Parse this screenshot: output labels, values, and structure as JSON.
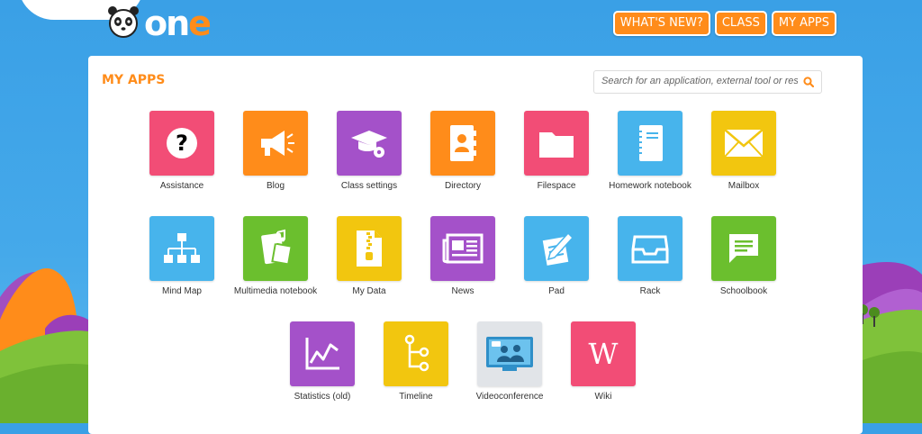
{
  "brand": {
    "logo_text_a": "on",
    "logo_text_b": "e"
  },
  "topnav": [
    {
      "label": "What's new?"
    },
    {
      "label": "Class"
    },
    {
      "label": "My apps"
    }
  ],
  "main": {
    "title": "MY APPS",
    "search_placeholder": "Search for an application, external tool or resource"
  },
  "apps": [
    {
      "label": "Assistance",
      "icon": "question-icon",
      "color": "#f24d76"
    },
    {
      "label": "Blog",
      "icon": "megaphone-icon",
      "color": "#ff8c1a"
    },
    {
      "label": "Class settings",
      "icon": "graduation-cap-gear-icon",
      "color": "#a451c9"
    },
    {
      "label": "Directory",
      "icon": "contact-book-icon",
      "color": "#ff8c1a"
    },
    {
      "label": "Filespace",
      "icon": "folder-icon",
      "color": "#f24d76"
    },
    {
      "label": "Homework notebook",
      "icon": "notebook-icon",
      "color": "#47b4ec"
    },
    {
      "label": "Mailbox",
      "icon": "envelope-icon",
      "color": "#f2c60f"
    },
    {
      "label": "Mind Map",
      "icon": "org-chart-icon",
      "color": "#47b4ec"
    },
    {
      "label": "Multimedia notebook",
      "icon": "multimedia-notebook-icon",
      "color": "#6bbf2e"
    },
    {
      "label": "My Data",
      "icon": "zip-file-icon",
      "color": "#f2c60f"
    },
    {
      "label": "News",
      "icon": "newspaper-icon",
      "color": "#a451c9"
    },
    {
      "label": "Pad",
      "icon": "pad-pencil-icon",
      "color": "#47b4ec"
    },
    {
      "label": "Rack",
      "icon": "inbox-tray-icon",
      "color": "#47b4ec"
    },
    {
      "label": "Schoolbook",
      "icon": "speech-bubble-icon",
      "color": "#6bbf2e"
    },
    {
      "label": "Statistics (old)",
      "icon": "line-chart-icon",
      "color": "#a451c9"
    },
    {
      "label": "Timeline",
      "icon": "timeline-icon",
      "color": "#f2c60f"
    },
    {
      "label": "Videoconference",
      "icon": "videoconference-icon",
      "color": "#e1e4e8"
    },
    {
      "label": "Wiki",
      "icon": "wikipedia-icon",
      "color": "#f24d76"
    }
  ]
}
